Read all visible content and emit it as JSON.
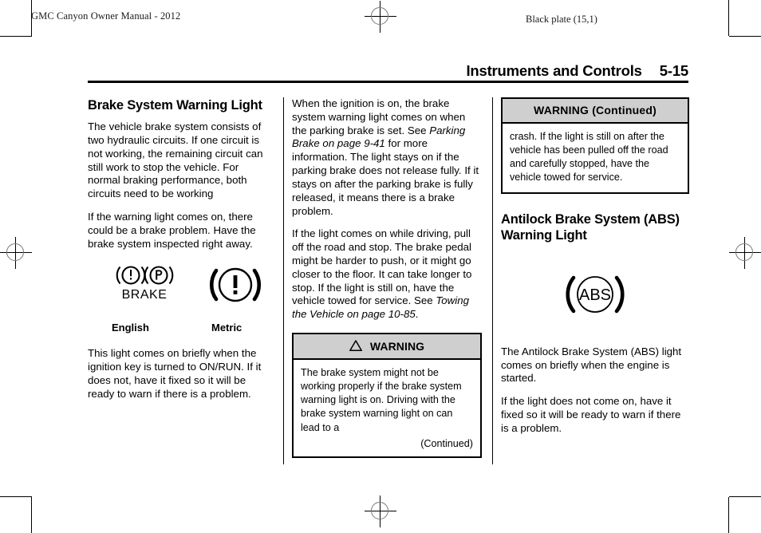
{
  "page": {
    "running_head_left": "GMC Canyon Owner Manual - 2012",
    "running_head_right": "Black plate (15,1)",
    "chapter_title": "Instruments and Controls",
    "page_number": "5-15"
  },
  "column1": {
    "heading": "Brake System Warning Light",
    "paragraph1": "The vehicle brake system consists of two hydraulic circuits. If one circuit is not working, the remaining circuit can still work to stop the vehicle. For normal braking performance, both circuits need to be working",
    "paragraph2": "If the warning light comes on, there could be a brake problem. Have the brake system inspected right away.",
    "icon_english_name": "brake-warning-english-icon",
    "icon_metric_name": "brake-warning-metric-icon",
    "label_english": "English",
    "label_metric": "Metric",
    "paragraph3": "This light comes on briefly when the ignition key is turned to ON/RUN. If it does not, have it fixed so it will be ready to warn if there is a problem."
  },
  "column2": {
    "paragraph1_a": "When the ignition is on, the brake system warning light comes on when the parking brake is set. See ",
    "paragraph1_italic": "Parking Brake on page 9-41",
    "paragraph1_b": " for more information. The light stays on if the parking brake does not release fully. If it stays on after the parking brake is fully released, it means there is a brake problem.",
    "paragraph2_a": "If the light comes on while driving, pull off the road and stop. The brake pedal might be harder to push, or it might go closer to the floor. It can take longer to stop. If the light is still on, have the vehicle towed for service. See ",
    "paragraph2_italic": "Towing the Vehicle on page 10-85",
    "paragraph2_b": ".",
    "warning": {
      "title": "WARNING",
      "triangle_icon": "warning-triangle-icon",
      "body": "The brake system might not be working properly if the brake system warning light is on. Driving with the brake system warning light on can lead to a",
      "continued": "(Continued)"
    }
  },
  "column3": {
    "warning_continued": {
      "title": "WARNING  (Continued)",
      "body": "crash. If the light is still on after the vehicle has been pulled off the road and carefully stopped, have the vehicle towed for service."
    },
    "heading": "Antilock Brake System (ABS) Warning Light",
    "icon_abs_name": "abs-warning-icon",
    "paragraph1": "The Antilock Brake System (ABS) light comes on briefly when the engine is started.",
    "paragraph2": "If the light does not come on, have it fixed so it will be ready to warn if there is a problem."
  },
  "colors": {
    "text": "#000000",
    "warning_header_bg": "#cfcfcf",
    "rule": "#000000"
  }
}
